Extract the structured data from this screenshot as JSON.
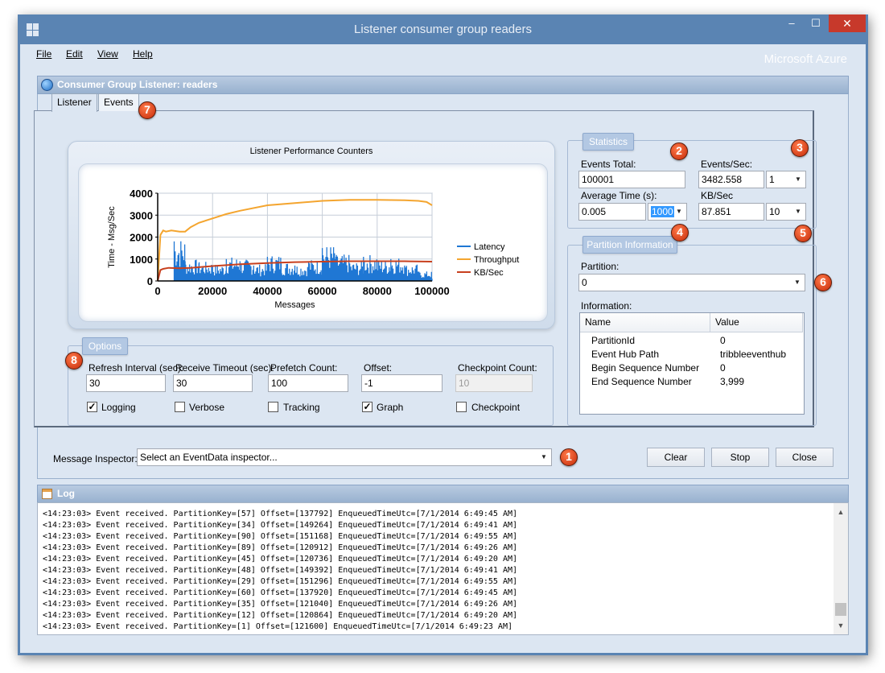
{
  "window": {
    "title": "Listener consumer group readers",
    "controls": {
      "minimize": "–",
      "maximize": "☐",
      "close": "✕"
    }
  },
  "menu": {
    "file": "File",
    "edit": "Edit",
    "view": "View",
    "help": "Help"
  },
  "brand": "Microsoft Azure",
  "listener_panel": {
    "header": "Consumer Group Listener: readers",
    "tabs": [
      {
        "label": "Listener",
        "active": true
      },
      {
        "label": "Events",
        "active": false
      }
    ]
  },
  "chart_title": "Listener Performance Counters",
  "chart_data": {
    "type": "line",
    "title": "Listener Performance Counters",
    "xlabel": "Messages",
    "ylabel": "Time - Msg/Sec",
    "xlim": [
      0,
      100000
    ],
    "ylim": [
      0,
      4000
    ],
    "xticks": [
      0,
      20000,
      40000,
      60000,
      80000,
      100000
    ],
    "yticks": [
      0,
      1000,
      2000,
      3000,
      4000
    ],
    "grid": true,
    "legend_position": "right",
    "series": [
      {
        "name": "Latency",
        "color": "#1f77d4",
        "style": "spiky",
        "x": [
          6000,
          10000,
          15000,
          20000,
          25000,
          30000,
          35000,
          40000,
          45000,
          50000,
          55000,
          60000,
          65000,
          70000,
          75000,
          80000,
          85000,
          90000,
          95000,
          100000
        ],
        "y": [
          1800,
          900,
          800,
          700,
          1000,
          900,
          700,
          1100,
          800,
          700,
          900,
          1500,
          1100,
          800,
          1100,
          900,
          1000,
          700,
          400,
          100
        ]
      },
      {
        "name": "Throughput",
        "color": "#f4a52f",
        "x": [
          0,
          1000,
          2000,
          3000,
          5000,
          8000,
          10000,
          12000,
          15000,
          20000,
          25000,
          30000,
          40000,
          50000,
          60000,
          70000,
          80000,
          90000,
          95000,
          98000,
          100000
        ],
        "y": [
          0,
          2100,
          2300,
          2250,
          2300,
          2250,
          2250,
          2450,
          2650,
          2850,
          3050,
          3200,
          3450,
          3550,
          3650,
          3700,
          3700,
          3680,
          3650,
          3600,
          3450
        ]
      },
      {
        "name": "KB/Sec",
        "color": "#c8401e",
        "x": [
          0,
          1000,
          2000,
          4000,
          8000,
          12000,
          20000,
          30000,
          40000,
          50000,
          60000,
          70000,
          80000,
          90000,
          100000
        ],
        "y": [
          0,
          500,
          550,
          600,
          580,
          600,
          680,
          760,
          820,
          860,
          880,
          900,
          900,
          900,
          880
        ]
      }
    ]
  },
  "statistics": {
    "legend": "Statistics",
    "events_total_label": "Events Total:",
    "events_total": "100001",
    "events_sec_label": "Events/Sec:",
    "events_sec": "3482.558",
    "events_sec_combo": "1",
    "avg_time_label": "Average Time (s):",
    "avg_time": "0.005",
    "avg_time_combo": "1000",
    "kb_sec_label": "KB/Sec",
    "kb_sec": "87.851",
    "kb_sec_combo": "10"
  },
  "partition": {
    "legend": "Partition Information",
    "partition_label": "Partition:",
    "partition_value": "0",
    "information_label": "Information:",
    "columns": [
      "Name",
      "Value"
    ],
    "rows": [
      {
        "name": "PartitionId",
        "value": "0"
      },
      {
        "name": "Event Hub Path",
        "value": "tribbleeventhub"
      },
      {
        "name": "Begin Sequence Number",
        "value": "0"
      },
      {
        "name": "End Sequence Number",
        "value": "3,999"
      }
    ]
  },
  "options": {
    "legend": "Options",
    "refresh_label": "Refresh Interval (sec):",
    "refresh": "30",
    "receive_timeout_label": "Receive Timeout (sec):",
    "receive_timeout": "30",
    "prefetch_label": "Prefetch Count:",
    "prefetch": "100",
    "offset_label": "Offset:",
    "offset": "-1",
    "checkpoint_count_label": "Checkpoint Count:",
    "checkpoint_count": "10",
    "checkboxes": [
      {
        "label": "Logging",
        "checked": true
      },
      {
        "label": "Verbose",
        "checked": false
      },
      {
        "label": "Tracking",
        "checked": false
      },
      {
        "label": "Graph",
        "checked": true
      },
      {
        "label": "Checkpoint",
        "checked": false
      }
    ]
  },
  "inspector": {
    "label": "Message Inspector:",
    "value": "Select an EventData inspector..."
  },
  "buttons": {
    "clear": "Clear",
    "stop": "Stop",
    "close": "Close"
  },
  "log": {
    "header": "Log",
    "lines": [
      "<14:23:03> Event received. PartitionKey=[57] Offset=[137792] EnqueuedTimeUtc=[7/1/2014 6:49:45 AM]",
      "<14:23:03> Event received. PartitionKey=[34] Offset=[149264] EnqueuedTimeUtc=[7/1/2014 6:49:41 AM]",
      "<14:23:03> Event received. PartitionKey=[90] Offset=[151168] EnqueuedTimeUtc=[7/1/2014 6:49:55 AM]",
      "<14:23:03> Event received. PartitionKey=[89] Offset=[120912] EnqueuedTimeUtc=[7/1/2014 6:49:26 AM]",
      "<14:23:03> Event received. PartitionKey=[45] Offset=[120736] EnqueuedTimeUtc=[7/1/2014 6:49:20 AM]",
      "<14:23:03> Event received. PartitionKey=[48] Offset=[149392] EnqueuedTimeUtc=[7/1/2014 6:49:41 AM]",
      "<14:23:03> Event received. PartitionKey=[29] Offset=[151296] EnqueuedTimeUtc=[7/1/2014 6:49:55 AM]",
      "<14:23:03> Event received. PartitionKey=[60] Offset=[137920] EnqueuedTimeUtc=[7/1/2014 6:49:45 AM]",
      "<14:23:03> Event received. PartitionKey=[35] Offset=[121040] EnqueuedTimeUtc=[7/1/2014 6:49:26 AM]",
      "<14:23:03> Event received. PartitionKey=[12] Offset=[120864] EnqueuedTimeUtc=[7/1/2014 6:49:20 AM]",
      "<14:23:03> Event received. PartitionKey=[1] Offset=[121600] EnqueuedTimeUtc=[7/1/2014 6:49:23 AM]"
    ]
  },
  "callouts": [
    "1",
    "2",
    "3",
    "4",
    "5",
    "6",
    "7",
    "8"
  ]
}
